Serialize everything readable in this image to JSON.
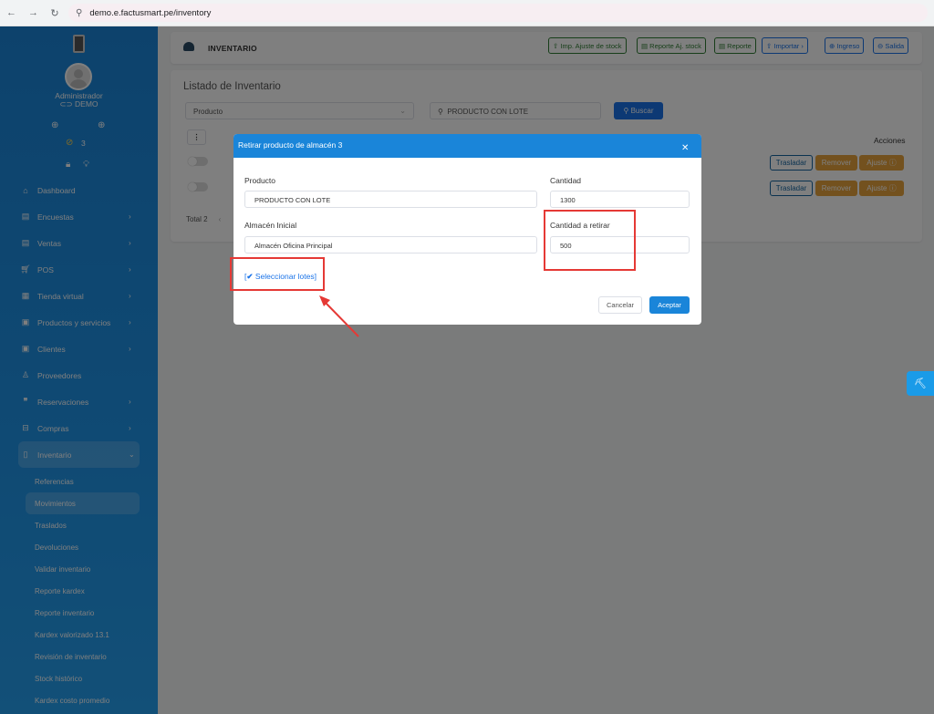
{
  "browser": {
    "url": "demo.e.factusmart.pe/inventory"
  },
  "sidebar": {
    "user_role": "Administrador",
    "user_company": "⊂⊃ DEMO",
    "badge_count": "3",
    "menu": [
      {
        "label": "Dashboard",
        "icon": "home-icon"
      },
      {
        "label": "Encuestas",
        "icon": "document-icon"
      },
      {
        "label": "Ventas",
        "icon": "document-icon"
      },
      {
        "label": "POS",
        "icon": "cart-icon"
      },
      {
        "label": "Tienda virtual",
        "icon": "store-icon"
      },
      {
        "label": "Productos y servicios",
        "icon": "boxes-icon"
      },
      {
        "label": "Clientes",
        "icon": "users-icon"
      },
      {
        "label": "Proveedores",
        "icon": "person-icon"
      },
      {
        "label": "Reservaciones",
        "icon": "quote-icon"
      },
      {
        "label": "Compras",
        "icon": "bag-icon"
      },
      {
        "label": "Inventario",
        "icon": "book-icon"
      }
    ],
    "submenu": [
      "Referencias",
      "Movimientos",
      "Traslados",
      "Devoluciones",
      "Validar inventario",
      "Reporte kardex",
      "Reporte inventario",
      "Kardex valorizado 13.1",
      "Revisión de inventario",
      "Stock histórico",
      "Kardex costo promedio"
    ]
  },
  "header": {
    "title": "INVENTARIO",
    "buttons": [
      "Imp. Ajuste de stock",
      "Reporte Aj. stock",
      "Reporte",
      "Importar",
      "Ingreso",
      "Salida"
    ]
  },
  "list": {
    "title": "Listado de Inventario",
    "filter_select": "Producto",
    "search_value": "PRODUCTO CON LOTE",
    "search_button": "Buscar",
    "actions_header": "Acciones",
    "row_buttons": {
      "transfer": "Trasladar",
      "remove": "Remover",
      "adjust": "Ajuste"
    },
    "total": "Total 2"
  },
  "modal": {
    "title": "Retirar producto de almacén 3",
    "product_label": "Producto",
    "product_value": "PRODUCTO CON LOTE",
    "quantity_label": "Cantidad",
    "quantity_value": "1300",
    "warehouse_label": "Almacén Inicial",
    "warehouse_value": "Almacén Oficina Principal",
    "withdraw_label": "Cantidad a retirar",
    "withdraw_value": "500",
    "select_lots": "Seleccionar lotes",
    "cancel": "Cancelar",
    "accept": "Aceptar"
  },
  "colors": {
    "sidebar": "#1a85d9",
    "primary": "#1a73e8",
    "warning": "#e6a23c",
    "annotation": "#e53935"
  }
}
